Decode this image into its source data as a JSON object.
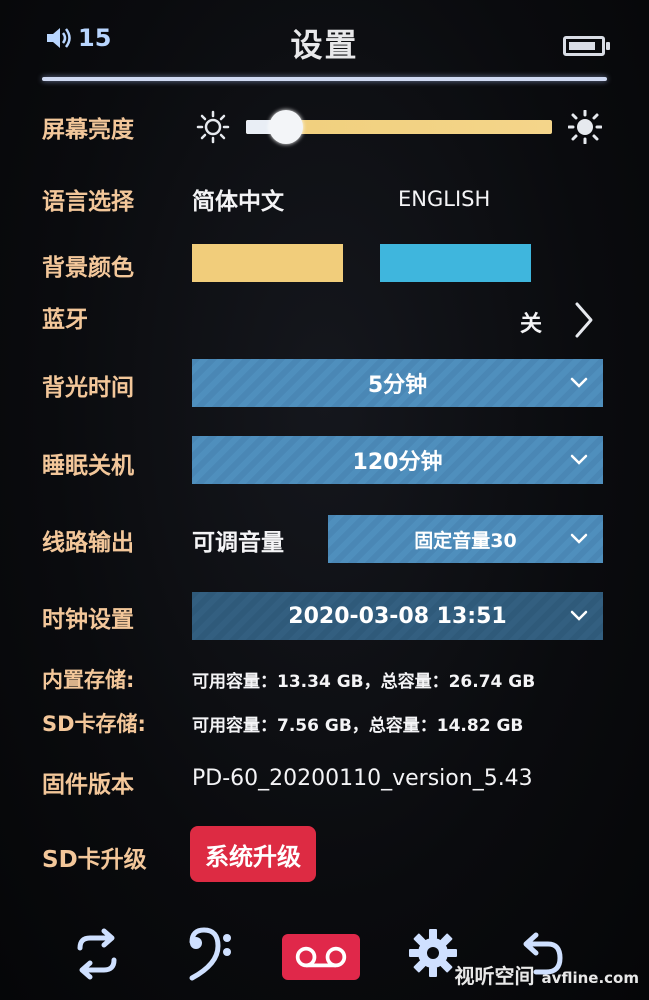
{
  "status": {
    "volume_level": "15",
    "title": "设置",
    "battery_level": 0.85
  },
  "rows": {
    "brightness": {
      "label": "屏幕亮度",
      "value": 0.13
    },
    "language": {
      "label": "语言选择",
      "option_cn": "简体中文",
      "option_en": "ENGLISH"
    },
    "background": {
      "label": "背景颜色",
      "color_1": "#f1cd7b",
      "color_2": "#3fb6dd"
    },
    "bluetooth": {
      "label": "蓝牙",
      "value": "关"
    },
    "backlight": {
      "label": "背光时间",
      "value": "5分钟"
    },
    "sleep": {
      "label": "睡眠关机",
      "value": "120分钟"
    },
    "line_out": {
      "label": "线路输出",
      "mode": "可调音量",
      "value": "固定音量30"
    },
    "clock": {
      "label": "时钟设置",
      "value": "2020-03-08 13:51"
    },
    "internal_storage": {
      "label": "内置存储:",
      "value": "可用容量：13.34 GB，总容量：26.74 GB"
    },
    "sd_storage": {
      "label": "SD卡存储:",
      "value": "可用容量：7.56 GB，总容量：14.82 GB"
    },
    "firmware": {
      "label": "固件版本",
      "value": "PD-60_20200110_version_5.43"
    },
    "sd_upgrade": {
      "label": "SD卡升级",
      "button": "系统升级"
    }
  },
  "nav": {
    "icons": [
      "repeat-icon",
      "bass-clef-icon",
      "cassette-icon",
      "gear-icon",
      "back-icon"
    ]
  },
  "watermark": {
    "cn": "视听空间",
    "url": "avfline.com"
  },
  "colors": {
    "label": "#f3c79a",
    "dropdown": "#4a87b5",
    "accent_red": "#dd2b43"
  }
}
